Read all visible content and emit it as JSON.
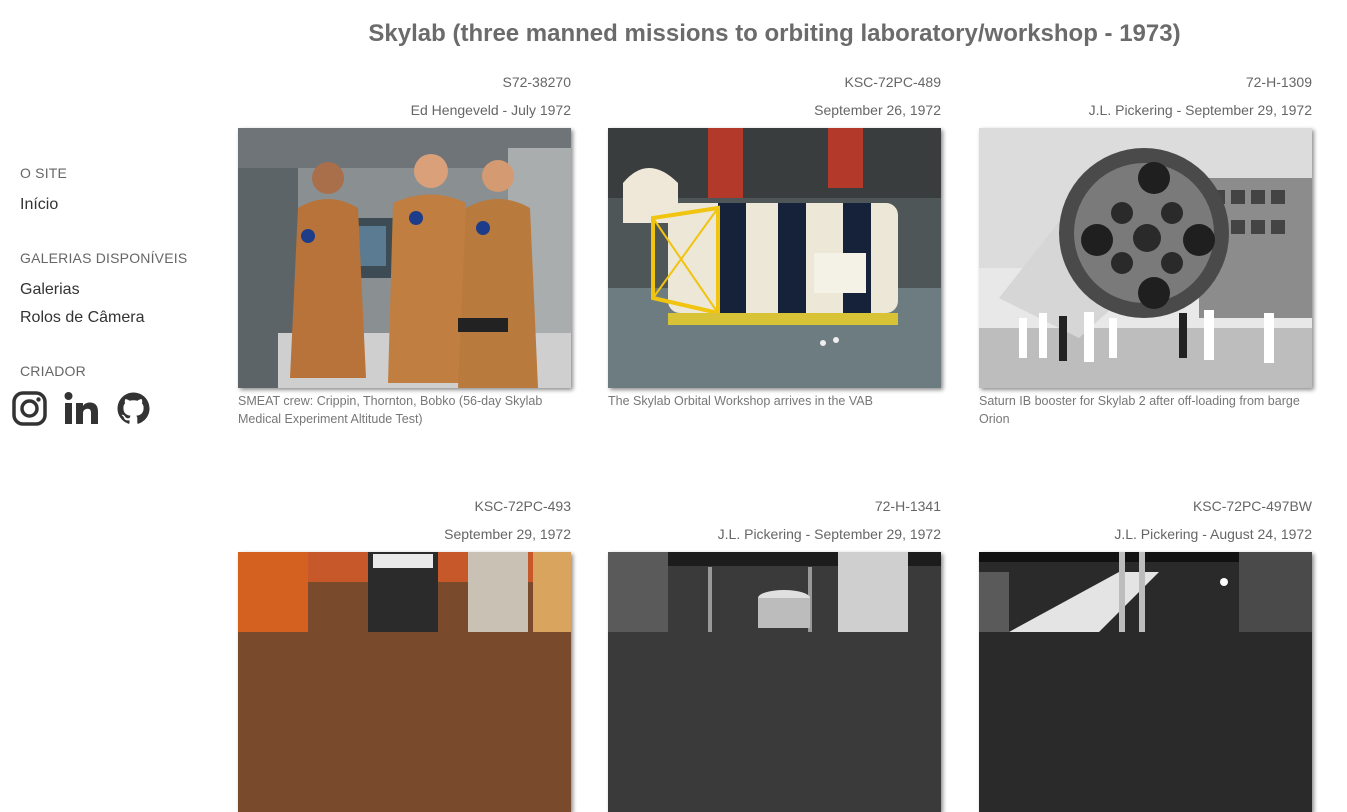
{
  "sidebar": {
    "section_site": "O SITE",
    "home": "Início",
    "section_galleries": "GALERIAS DISPONÍVEIS",
    "galleries": "Galerias",
    "camera_rolls": "Rolos de Câmera",
    "section_creator": "CRIADOR",
    "social": [
      "instagram-icon",
      "linkedin-icon",
      "github-icon"
    ]
  },
  "page": {
    "title": "Skylab (three manned missions to orbiting laboratory/workshop - 1973)"
  },
  "photos": [
    {
      "code": "S72-38270",
      "meta": "Ed Hengeveld  - July 1972",
      "caption": "SMEAT crew: Crippin, Thornton, Bobko (56-day Skylab Medical Experiment Altitude Test)"
    },
    {
      "code": "KSC-72PC-489",
      "meta": "September 26, 1972",
      "caption": "The Skylab Orbital Workshop arrives in the VAB"
    },
    {
      "code": "72-H-1309",
      "meta": "J.L. Pickering  - September 29, 1972",
      "caption": "Saturn IB booster for Skylab 2 after off-loading from barge Orion"
    },
    {
      "code": "KSC-72PC-493",
      "meta": "September 29, 1972",
      "caption": ""
    },
    {
      "code": "72-H-1341",
      "meta": "J.L. Pickering  - September 29, 1972",
      "caption": ""
    },
    {
      "code": "KSC-72PC-497BW",
      "meta": "J.L. Pickering  - August 24, 1972",
      "caption": ""
    }
  ]
}
